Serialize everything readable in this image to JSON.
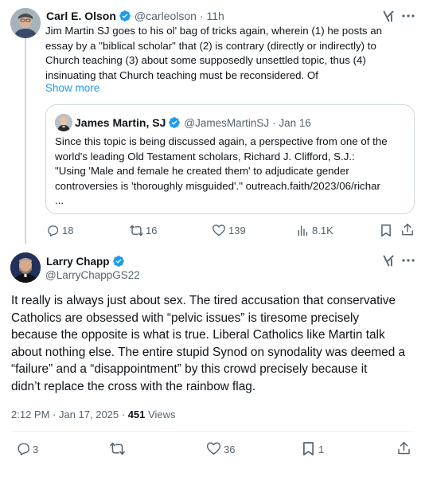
{
  "parent_tweet": {
    "author_name": "Carl E. Olson",
    "author_handle": "@carleolson",
    "time": "· 11h",
    "text_lines": [
      "Jim Martin SJ goes to his ol' bag of tricks again, wherein (1) he posts an",
      "essay by a \"biblical scholar\" that (2) is contrary (directly or indirectly) to",
      "Church teaching (3) about some supposedly unsettled topic, thus (4)",
      "insinuating that Church teaching must be reconsidered. Of"
    ],
    "show_more": "Show more",
    "quoted": {
      "author_name": "James Martin, SJ",
      "author_handle": "@JamesMartinSJ",
      "date": "· Jan 16",
      "text_lines": [
        "Since this topic is being discussed again, a perspective from one of the",
        "world's leading Old Testament scholars, Richard J. Clifford, S.J.:",
        "\"Using 'Male and female he created them' to adjudicate gender",
        "controversies is 'thoroughly misguided'.\"  outreach.faith/2023/06/richar",
        "..."
      ]
    },
    "actions": {
      "replies": "18",
      "reposts": "16",
      "likes": "139",
      "views": "8.1K"
    }
  },
  "main_tweet": {
    "author_name": "Larry Chapp",
    "author_handle": "@LarryChappGS22",
    "text_lines": [
      "It really is always just about sex. The tired accusation that conservative",
      "Catholics are obsessed with “pelvic issues” is tiresome precisely",
      "because the opposite is what is true. Liberal Catholics like Martin talk",
      "about nothing else. The entire stupid Synod on synodality was deemed a",
      "“failure” and a “disappointment” by this crowd precisely because it",
      "didn’t replace the cross with the rainbow flag."
    ],
    "meta_time": "2:12 PM · Jan 17, 2025 · ",
    "meta_views_count": "451",
    "meta_views_label": " Views",
    "actions": {
      "replies": "3",
      "reposts": "",
      "likes": "36",
      "bookmarks": "1"
    }
  },
  "colors": {
    "verified": "#1d9bf0",
    "link": "#1d9bf0",
    "muted": "#536471",
    "border": "#cfd9de"
  },
  "icons": [
    "grok-icon",
    "more-icon",
    "verified-icon",
    "reply-icon",
    "repost-icon",
    "like-icon",
    "views-icon",
    "bookmark-icon",
    "share-icon"
  ]
}
